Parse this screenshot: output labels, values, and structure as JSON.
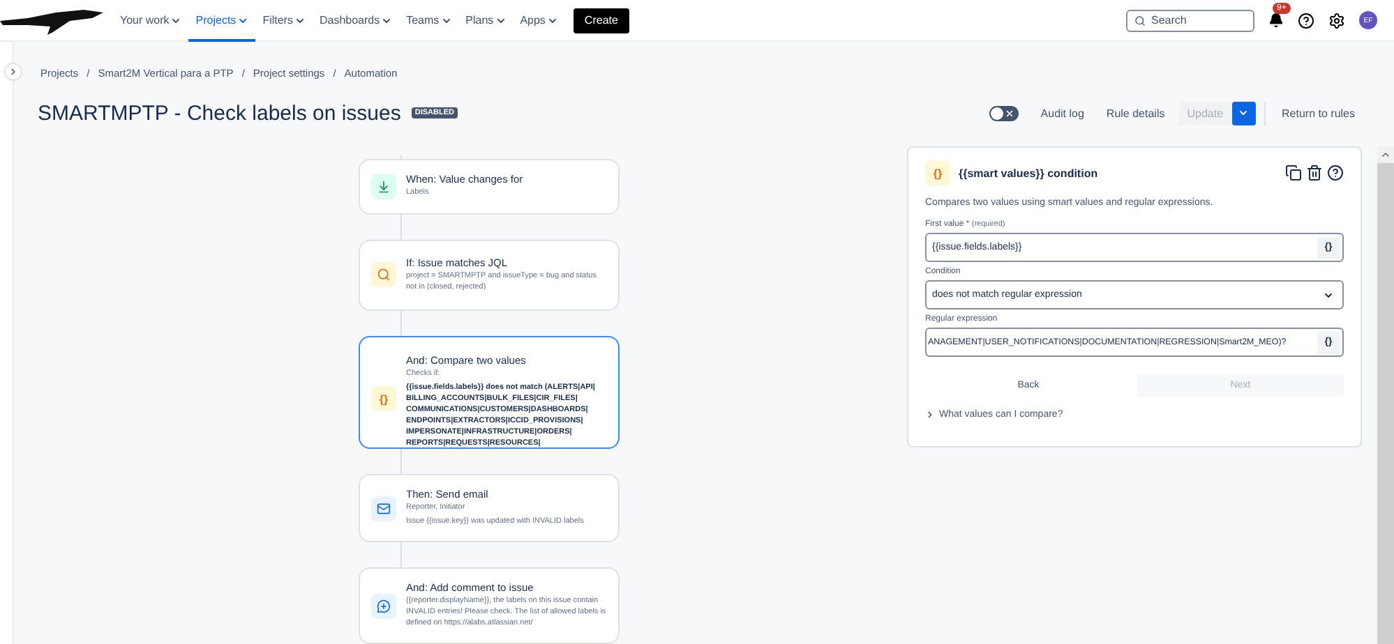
{
  "nav": {
    "items": [
      {
        "label": "Your work",
        "selected": false
      },
      {
        "label": "Projects",
        "selected": true
      },
      {
        "label": "Filters",
        "selected": false
      },
      {
        "label": "Dashboards",
        "selected": false
      },
      {
        "label": "Teams",
        "selected": false
      },
      {
        "label": "Plans",
        "selected": false
      },
      {
        "label": "Apps",
        "selected": false
      }
    ],
    "create": "Create",
    "search": {
      "placeholder": "Search"
    },
    "notifications_badge": "9+",
    "avatar": "EF"
  },
  "breadcrumbs": [
    "Projects",
    "Smart2M Vertical para a PTP",
    "Project settings",
    "Automation"
  ],
  "breadcrumb_separators": [
    "/",
    "/",
    "/"
  ],
  "rule": {
    "title": "SMARTMPTP - Check labels on issues",
    "status": "DISABLED",
    "enabled": false
  },
  "toolbar": {
    "audit_log": "Audit log",
    "rule_details": "Rule details",
    "update": "Update",
    "update_disabled": true,
    "return": "Return to rules"
  },
  "steps": [
    {
      "kind": "trigger",
      "title": "When: Value changes for",
      "selected": false,
      "lines": [
        "Labels"
      ]
    },
    {
      "kind": "condition",
      "title": "If: Issue matches JQL",
      "selected": false,
      "lines": [
        "project = SMARTMPTP and issueType = bug and status not in (closed, rejected)"
      ]
    },
    {
      "kind": "compare",
      "title": "And: Compare two values",
      "selected": true,
      "icon_text": "{}",
      "lines": [
        "Checks if:"
      ],
      "expression": [
        "{{issue.fields.labels}} does not match (ALERTS|API|",
        "BILLING_ACCOUNTS|BULK_FILES|CIR_FILES|",
        "COMMUNICATIONS|CUSTOMERS|DASHBOARDS|",
        "ENDPOINTS|EXTRACTORS|ICCID_PROVISIONS|",
        "IMPERSONATE|INFRASTRUCTURE|ORDERS|",
        "REPORTS|REQUESTS|RESOURCES|"
      ]
    },
    {
      "kind": "email",
      "title": "Then: Send email",
      "selected": false,
      "lines": [
        "Reporter, Initiator",
        "Issue {{issue.key}} was updated with INVALID labels"
      ]
    },
    {
      "kind": "comment",
      "title": "And: Add comment to issue",
      "selected": false,
      "lines": [
        "{{reporter.displayName}}, the labels on this issue contain INVALID entries! Please check. The list of allowed labels is defined on https://alabs.atlassian.net/"
      ]
    }
  ],
  "panel": {
    "icon_text": "{}",
    "title": "{{smart values}} condition",
    "description": "Compares two values using smart values and regular expressions.",
    "first_value": {
      "label": "First value",
      "required_mark": "*",
      "hint": "(required)",
      "value": "{{issue.fields.labels}}",
      "button": "{}"
    },
    "condition": {
      "label": "Condition",
      "value": "does not match regular expression"
    },
    "regex": {
      "label": "Regular expression",
      "value": "ANAGEMENT|USER_NOTIFICATIONS|DOCUMENTATION|REGRESSION|Smart2M_MEO)?",
      "button": "{}"
    },
    "back": "Back",
    "next": "Next",
    "next_disabled": true,
    "help": "What values can I compare?"
  }
}
